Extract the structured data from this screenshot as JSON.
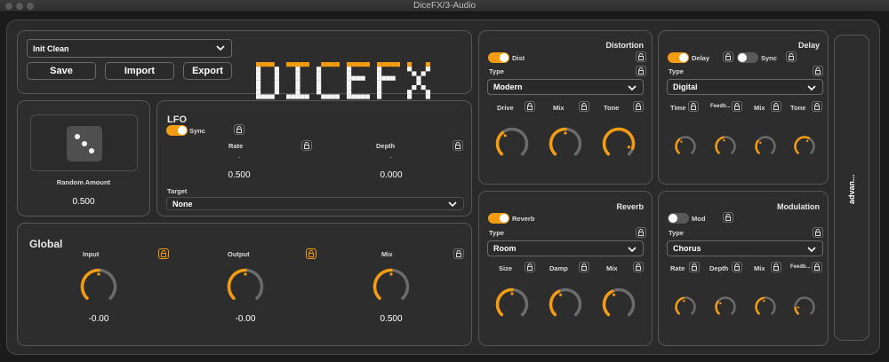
{
  "window": {
    "title": "DiceFX/3-Audio"
  },
  "preset": {
    "name": "Init Clean",
    "save": "Save",
    "import": "Import",
    "export": "Export"
  },
  "logo": {
    "text": "DICEFX",
    "color": "#f39c12"
  },
  "random": {
    "label": "Random Amount",
    "value": "0.500",
    "icon": "dice-icon"
  },
  "lfo": {
    "title": "LFO",
    "sync_label": "Sync",
    "rate_label": "Rate",
    "depth_label": "Depth",
    "rate_value": "0.500",
    "depth_value": "0.000",
    "target_label": "Target",
    "target_value": "None",
    "rate_marker": ".",
    "depth_marker": "."
  },
  "global": {
    "title": "Global",
    "input_label": "Input",
    "output_label": "Output",
    "mix_label": "Mix",
    "input_value": "-0.00",
    "output_value": "-0.00",
    "mix_value": "0.500"
  },
  "distortion": {
    "title": "Distortion",
    "toggle_label": "Dist",
    "type_label": "Type",
    "type_value": "Modern",
    "drive_label": "Drive",
    "mix_label": "Mix",
    "tone_label": "Tone"
  },
  "delay": {
    "title": "Delay",
    "toggle_label": "Delay",
    "sync_label": "Sync",
    "type_label": "Type",
    "type_value": "Digital",
    "time_label": "Time",
    "feedback_label": "Feedb...",
    "mix_label": "Mix",
    "tone_label": "Tone"
  },
  "reverb": {
    "title": "Reverb",
    "toggle_label": "Reverb",
    "type_label": "Type",
    "type_value": "Room",
    "size_label": "Size",
    "damp_label": "Damp",
    "mix_label": "Mix"
  },
  "modulation": {
    "title": "Modulation",
    "toggle_label": "Mod",
    "type_label": "Type",
    "type_value": "Chorus",
    "rate_label": "Rate",
    "depth_label": "Depth",
    "mix_label": "Mix",
    "feedback_label": "Feedb..."
  },
  "advanced": {
    "label": "advan..."
  },
  "colors": {
    "accent": "#f39c12",
    "track": "#6b6b6b",
    "panel": "#2d2d2d"
  },
  "knobs": {
    "global_input": 0.5,
    "global_output": 0.5,
    "global_mix": 0.5,
    "dist_drive": 0.35,
    "dist_mix": 0.5,
    "dist_tone": 0.9,
    "delay_time": 0.35,
    "delay_feedback": 0.45,
    "delay_mix": 0.3,
    "delay_tone": 0.6,
    "reverb_size": 0.5,
    "reverb_damp": 0.4,
    "reverb_mix": 0.4,
    "mod_rate": 0.45,
    "mod_depth": 0.3,
    "mod_mix": 0.45,
    "mod_feedback": 0.15
  }
}
